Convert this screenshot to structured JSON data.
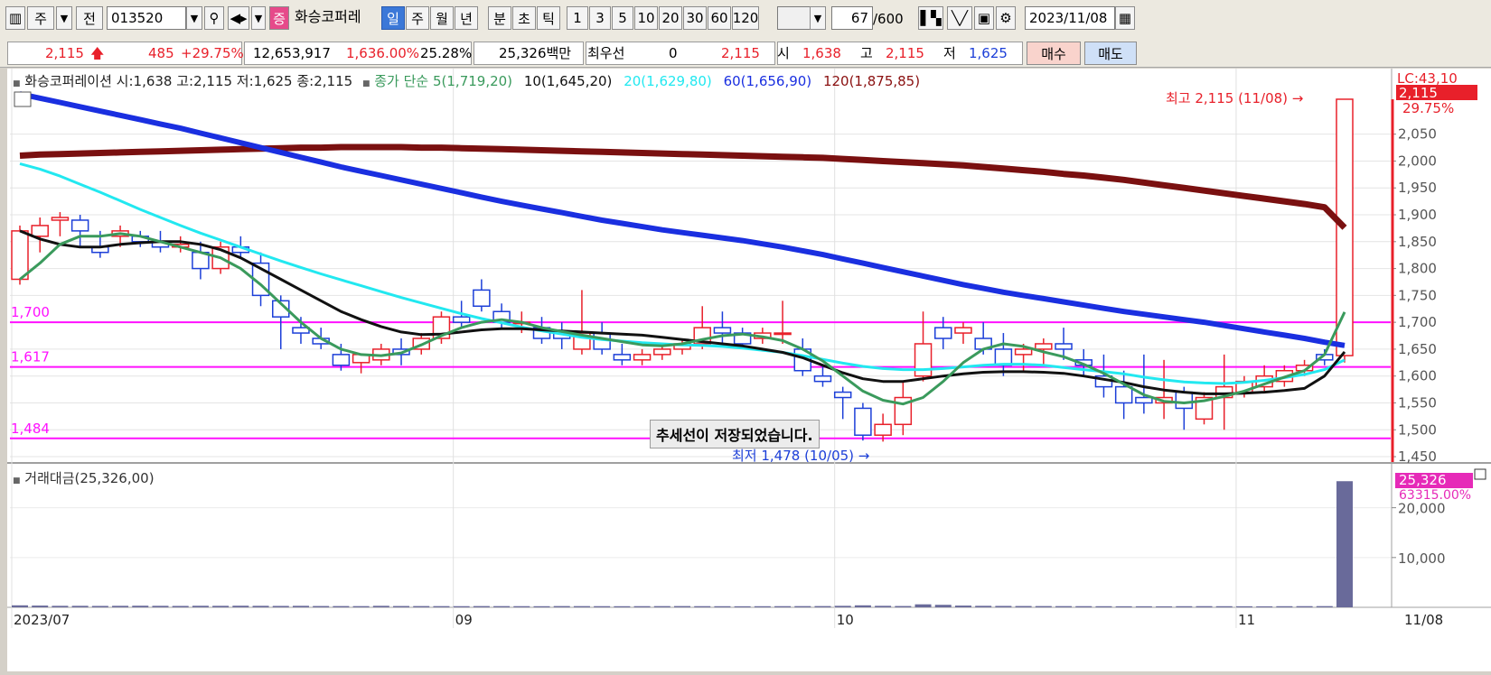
{
  "toolbar": {
    "code": "013520",
    "name": "화승코퍼레",
    "period_tabs": [
      "일",
      "주",
      "월",
      "년"
    ],
    "selected_period": "일",
    "intraday_tabs": [
      "분",
      "초",
      "틱"
    ],
    "numbers": [
      "1",
      "3",
      "5",
      "10",
      "20",
      "30",
      "60",
      "120"
    ],
    "count_value": "67",
    "count_total": "/600",
    "date": "2023/11/08",
    "btn_main": "주",
    "btn_prev": "전",
    "btn_jeung": "증"
  },
  "quote": {
    "price": "2,115",
    "change": "485",
    "change_pct": "+29.75%",
    "volume": "12,653,917",
    "volume_pct": "1,636.00%",
    "turnover": "25.28%",
    "amount": "25,326백만",
    "priority_label": "최우선",
    "priority_value": "0",
    "price2": "2,115",
    "open_label": "시",
    "open": "1,638",
    "high_label": "고",
    "high": "2,115",
    "low_label": "저",
    "low": "1,625",
    "buy_label": "매수",
    "sell_label": "매도"
  },
  "legend": {
    "stock": "화승코퍼레이션 시:1,638 고:2,115 저:1,625 종:2,115",
    "ma_title": "종가 단순",
    "ma5": "5(1,719,20)",
    "ma10": "10(1,645,20)",
    "ma20": "20(1,629,80)",
    "ma60": "60(1,656,90)",
    "ma120": "120(1,875,85)",
    "volume_title": "거래대금(25,326,00)"
  },
  "annotations": {
    "high": "최고 2,115 (11/08) →",
    "low": "최저 1,478 (10/05) →",
    "lc": "LC:43,10",
    "current_price_tag": "2,115",
    "current_pct_tag": "29.75%",
    "vol_tag": "25,326",
    "vol_pct_tag": "63315.00%",
    "popup": "추세선이 저장되었습니다."
  },
  "colors": {
    "up": "#e8202a",
    "down": "#1c3fd8",
    "ma5": "#3a9a5c",
    "ma10": "#111111",
    "ma20": "#22e8f0",
    "ma60": "#1a2fe0",
    "ma120": "#7a1010",
    "hline": "#ff10ff",
    "volume": "#696a9a"
  },
  "chart_data": {
    "type": "candlestick",
    "price_axis": {
      "ticks": [
        1450,
        1500,
        1550,
        1600,
        1650,
        1700,
        1750,
        1800,
        1850,
        1900,
        1950,
        2000,
        2050
      ],
      "tick_labels": [
        "1,450",
        "1,500",
        "1,550",
        "1,600",
        "1,650",
        "1,700",
        "1,750",
        "1,800",
        "1,850",
        "1,900",
        "1,950",
        "2,000",
        "2,050"
      ],
      "range": [
        1440,
        2125
      ]
    },
    "volume_axis": {
      "ticks": [
        10000,
        20000
      ],
      "tick_labels": [
        "10,000",
        "20,000"
      ],
      "range": [
        0,
        27000
      ]
    },
    "date_labels": [
      {
        "i": 0,
        "label": "2023/07"
      },
      {
        "i": 22,
        "label": "09"
      },
      {
        "i": 41,
        "label": "10"
      },
      {
        "i": 61,
        "label": "11"
      }
    ],
    "last_date_label": "11/08",
    "horizontal_lines": [
      {
        "value": 1700,
        "label": "1,700"
      },
      {
        "value": 1617,
        "label": "1,617"
      },
      {
        "value": 1484,
        "label": "1,484"
      }
    ],
    "candles": [
      [
        1780,
        1880,
        1770,
        1870
      ],
      [
        1860,
        1895,
        1830,
        1880
      ],
      [
        1890,
        1905,
        1860,
        1895
      ],
      [
        1890,
        1900,
        1840,
        1870
      ],
      [
        1840,
        1870,
        1820,
        1830
      ],
      [
        1860,
        1880,
        1840,
        1870
      ],
      [
        1860,
        1870,
        1840,
        1850
      ],
      [
        1850,
        1870,
        1830,
        1840
      ],
      [
        1840,
        1860,
        1830,
        1845
      ],
      [
        1830,
        1850,
        1780,
        1800
      ],
      [
        1800,
        1850,
        1790,
        1840
      ],
      [
        1840,
        1860,
        1820,
        1830
      ],
      [
        1810,
        1830,
        1730,
        1750
      ],
      [
        1740,
        1750,
        1650,
        1710
      ],
      [
        1690,
        1710,
        1660,
        1680
      ],
      [
        1670,
        1690,
        1650,
        1660
      ],
      [
        1640,
        1660,
        1610,
        1620
      ],
      [
        1625,
        1640,
        1605,
        1640
      ],
      [
        1630,
        1660,
        1620,
        1650
      ],
      [
        1650,
        1670,
        1620,
        1640
      ],
      [
        1650,
        1680,
        1640,
        1670
      ],
      [
        1670,
        1720,
        1660,
        1710
      ],
      [
        1710,
        1740,
        1690,
        1700
      ],
      [
        1760,
        1780,
        1720,
        1730
      ],
      [
        1720,
        1735,
        1690,
        1700
      ],
      [
        1700,
        1720,
        1680,
        1700
      ],
      [
        1690,
        1710,
        1660,
        1670
      ],
      [
        1680,
        1700,
        1650,
        1670
      ],
      [
        1650,
        1760,
        1640,
        1680
      ],
      [
        1680,
        1700,
        1640,
        1650
      ],
      [
        1640,
        1660,
        1620,
        1630
      ],
      [
        1630,
        1650,
        1620,
        1640
      ],
      [
        1640,
        1660,
        1630,
        1650
      ],
      [
        1650,
        1670,
        1640,
        1660
      ],
      [
        1660,
        1730,
        1650,
        1690
      ],
      [
        1690,
        1720,
        1660,
        1680
      ],
      [
        1680,
        1690,
        1650,
        1660
      ],
      [
        1670,
        1690,
        1660,
        1680
      ],
      [
        1680,
        1740,
        1660,
        1680
      ],
      [
        1650,
        1670,
        1600,
        1610
      ],
      [
        1600,
        1620,
        1580,
        1590
      ],
      [
        1570,
        1580,
        1520,
        1560
      ],
      [
        1540,
        1550,
        1480,
        1490
      ],
      [
        1490,
        1530,
        1478,
        1510
      ],
      [
        1510,
        1590,
        1490,
        1560
      ],
      [
        1600,
        1720,
        1590,
        1660
      ],
      [
        1690,
        1710,
        1650,
        1670
      ],
      [
        1680,
        1700,
        1660,
        1690
      ],
      [
        1670,
        1700,
        1640,
        1650
      ],
      [
        1650,
        1680,
        1600,
        1620
      ],
      [
        1640,
        1660,
        1610,
        1650
      ],
      [
        1650,
        1670,
        1620,
        1660
      ],
      [
        1660,
        1690,
        1630,
        1650
      ],
      [
        1630,
        1650,
        1600,
        1620
      ],
      [
        1600,
        1640,
        1560,
        1580
      ],
      [
        1580,
        1610,
        1520,
        1550
      ],
      [
        1560,
        1640,
        1530,
        1550
      ],
      [
        1550,
        1630,
        1520,
        1560
      ],
      [
        1570,
        1580,
        1500,
        1540
      ],
      [
        1520,
        1570,
        1510,
        1560
      ],
      [
        1560,
        1640,
        1500,
        1580
      ],
      [
        1570,
        1600,
        1560,
        1590
      ],
      [
        1580,
        1620,
        1570,
        1600
      ],
      [
        1590,
        1620,
        1580,
        1610
      ],
      [
        1610,
        1630,
        1600,
        1620
      ],
      [
        1640,
        1650,
        1620,
        1630
      ],
      [
        1638,
        2115,
        1625,
        2115
      ]
    ],
    "ma120": [
      2010,
      2012,
      2013,
      2014,
      2015,
      2016,
      2017,
      2018,
      2019,
      2020,
      2021,
      2022,
      2023,
      2024,
      2025,
      2025,
      2026,
      2026,
      2026,
      2026,
      2025,
      2025,
      2024,
      2023,
      2022,
      2021,
      2020,
      2019,
      2018,
      2017,
      2016,
      2015,
      2014,
      2013,
      2012,
      2011,
      2010,
      2009,
      2008,
      2007,
      2006,
      2004,
      2002,
      2000,
      1998,
      1996,
      1994,
      1992,
      1989,
      1986,
      1983,
      1980,
      1976,
      1973,
      1969,
      1965,
      1960,
      1955,
      1950,
      1945,
      1940,
      1935,
      1930,
      1925,
      1920,
      1914,
      1876
    ],
    "ma60": [
      2125,
      2117,
      2109,
      2101,
      2093,
      2085,
      2077,
      2069,
      2061,
      2052,
      2043,
      2034,
      2025,
      2016,
      2007,
      1998,
      1989,
      1981,
      1973,
      1965,
      1957,
      1949,
      1941,
      1933,
      1925,
      1918,
      1911,
      1904,
      1897,
      1890,
      1884,
      1878,
      1872,
      1867,
      1862,
      1857,
      1852,
      1846,
      1840,
      1833,
      1826,
      1818,
      1810,
      1802,
      1794,
      1786,
      1778,
      1770,
      1763,
      1756,
      1750,
      1744,
      1738,
      1732,
      1726,
      1720,
      1715,
      1710,
      1705,
      1700,
      1694,
      1688,
      1682,
      1676,
      1670,
      1663,
      1657
    ],
    "ma20": [
      1995,
      1985,
      1972,
      1957,
      1942,
      1926,
      1910,
      1895,
      1880,
      1866,
      1853,
      1840,
      1827,
      1814,
      1802,
      1790,
      1779,
      1768,
      1757,
      1746,
      1736,
      1726,
      1716,
      1707,
      1699,
      1691,
      1684,
      1678,
      1672,
      1668,
      1665,
      1662,
      1660,
      1658,
      1657,
      1655,
      1652,
      1648,
      1644,
      1638,
      1631,
      1624,
      1618,
      1614,
      1612,
      1612,
      1614,
      1617,
      1620,
      1622,
      1622,
      1620,
      1616,
      1612,
      1608,
      1604,
      1598,
      1593,
      1589,
      1587,
      1586,
      1588,
      1592,
      1597,
      1603,
      1612,
      1630
    ],
    "ma10": [
      1870,
      1855,
      1845,
      1840,
      1840,
      1845,
      1848,
      1850,
      1850,
      1845,
      1835,
      1820,
      1800,
      1780,
      1760,
      1740,
      1720,
      1705,
      1692,
      1682,
      1677,
      1678,
      1682,
      1686,
      1688,
      1688,
      1686,
      1684,
      1682,
      1680,
      1678,
      1676,
      1672,
      1668,
      1664,
      1660,
      1656,
      1650,
      1644,
      1634,
      1620,
      1606,
      1595,
      1590,
      1590,
      1595,
      1600,
      1604,
      1607,
      1608,
      1608,
      1607,
      1605,
      1600,
      1594,
      1588,
      1580,
      1574,
      1570,
      1567,
      1567,
      1568,
      1570,
      1573,
      1577,
      1600,
      1645
    ],
    "ma5": [
      1780,
      1810,
      1845,
      1860,
      1860,
      1865,
      1860,
      1850,
      1840,
      1830,
      1820,
      1800,
      1770,
      1735,
      1700,
      1670,
      1650,
      1640,
      1638,
      1643,
      1658,
      1675,
      1690,
      1700,
      1705,
      1700,
      1690,
      1683,
      1676,
      1670,
      1664,
      1658,
      1656,
      1660,
      1668,
      1675,
      1678,
      1673,
      1666,
      1650,
      1628,
      1600,
      1572,
      1555,
      1548,
      1560,
      1590,
      1625,
      1650,
      1660,
      1655,
      1645,
      1636,
      1622,
      1605,
      1585,
      1565,
      1553,
      1550,
      1554,
      1562,
      1572,
      1585,
      1598,
      1610,
      1640,
      1719
    ],
    "volume": [
      400,
      350,
      300,
      300,
      280,
      300,
      320,
      300,
      280,
      310,
      300,
      320,
      300,
      280,
      300,
      260,
      250,
      240,
      300,
      260,
      250,
      240,
      230,
      250,
      240,
      230,
      220,
      250,
      240,
      230,
      220,
      230,
      240,
      250,
      230,
      220,
      210,
      220,
      230,
      240,
      250,
      300,
      400,
      300,
      260,
      600,
      500,
      350,
      300,
      280,
      260,
      250,
      240,
      230,
      220,
      210,
      210,
      200,
      220,
      230,
      220,
      210,
      200,
      220,
      230,
      240,
      25326
    ]
  }
}
